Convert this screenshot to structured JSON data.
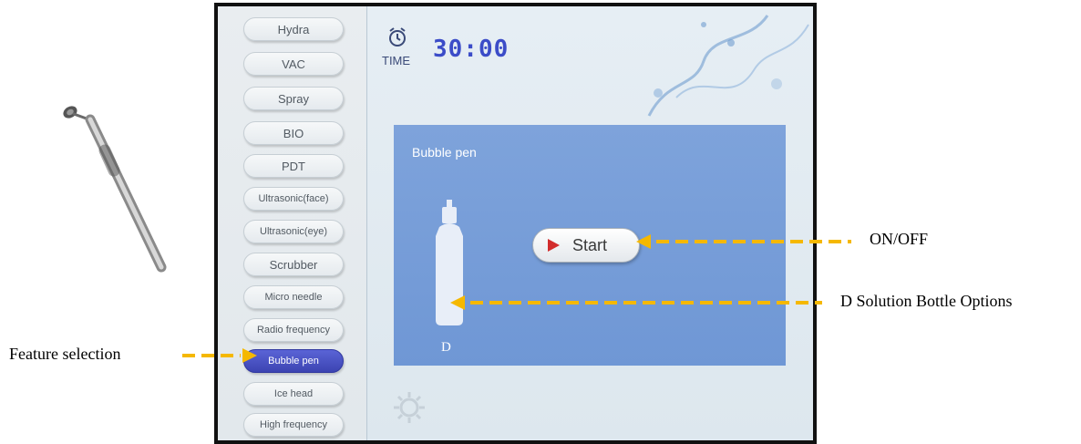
{
  "screen": {
    "sidebar": {
      "items": [
        {
          "label": "Hydra"
        },
        {
          "label": "VAC"
        },
        {
          "label": "Spray"
        },
        {
          "label": "BIO"
        },
        {
          "label": "PDT"
        },
        {
          "label": "Ultrasonic(face)"
        },
        {
          "label": "Ultrasonic(eye)"
        },
        {
          "label": "Scrubber"
        },
        {
          "label": "Micro needle"
        },
        {
          "label": "Radio frequency"
        },
        {
          "label": "Bubble pen",
          "selected": true
        },
        {
          "label": "Ice head"
        },
        {
          "label": "High frequency"
        }
      ]
    },
    "timer": {
      "label": "TIME",
      "value": "30:00",
      "icon": "alarm-clock-icon"
    },
    "panel": {
      "title": "Bubble pen",
      "bottle_label": "D",
      "start_label": "Start"
    }
  },
  "annotations": {
    "on_off": "ON/OFF",
    "bottle_options": "D Solution Bottle Options",
    "feature_selection": "Feature selection"
  },
  "colors": {
    "panel": "#7ea3db",
    "selected_item": "#4a53c4",
    "time_digits": "#3b4cc8",
    "arrow": "#f5b800",
    "play_icon": "#d22c2c"
  }
}
